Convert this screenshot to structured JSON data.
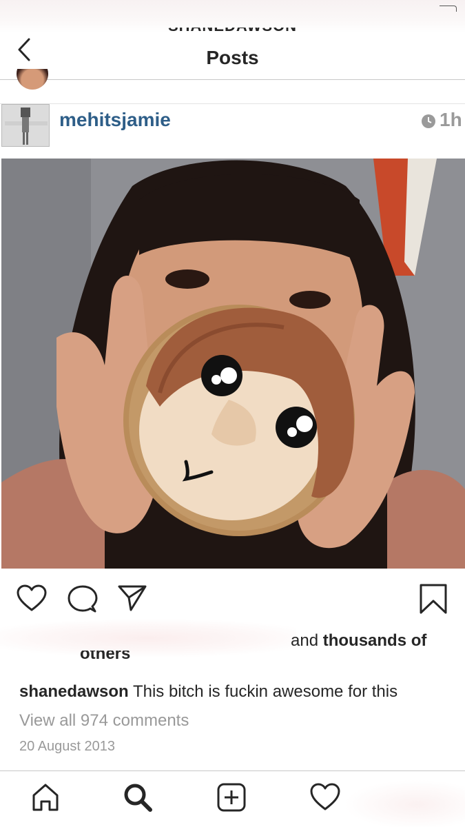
{
  "header": {
    "username_partial": "SHANEDAWSON",
    "title": "Posts"
  },
  "post": {
    "username": "mehitsjamie",
    "time": "1h",
    "likes": {
      "suffix": "and ",
      "bold": "thousands of",
      "wrap": "others"
    },
    "caption": {
      "user": "shanedawson",
      "text": "This bitch is fuckin awesome for this"
    },
    "view_comments": "View all 974 comments",
    "date": "20 August 2013"
  },
  "icons": {
    "back": "chevron-left-icon",
    "like": "heart-outline-icon",
    "comment": "speech-bubble-icon",
    "share": "paper-plane-icon",
    "save": "bookmark-icon",
    "home": "home-icon",
    "search": "search-icon",
    "add": "plus-square-icon",
    "activity": "heart-outline-icon"
  },
  "colors": {
    "username_link": "#2e5e88",
    "muted": "#999999",
    "text": "#262626"
  }
}
